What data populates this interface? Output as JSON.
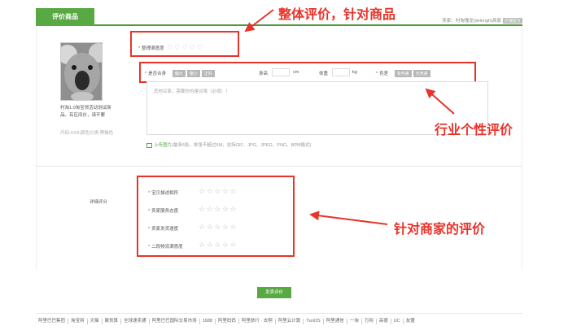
{
  "header": {
    "tab_label": "评价商品",
    "seller_prefix": "卖家：",
    "seller_name": "村淘懂龙(delongh)商家",
    "seller_badge": "店铺留言"
  },
  "product": {
    "title": "村淘1.0淘宝领活动测试商品。有区间价，请不要",
    "subtitle": "尺码:XXS;颜色分类:黑猫色"
  },
  "overall_rating": {
    "label": "整理满意度",
    "hearts": 5
  },
  "attributes": {
    "fit_label": "是否合身",
    "fit_options": [
      "偏大",
      "偏小",
      "正好"
    ],
    "height_label": "身高",
    "height_unit": "cm",
    "weight_label": "体重",
    "weight_unit": "kg",
    "color_label": "色差",
    "color_options": [
      "有色差",
      "无色差"
    ]
  },
  "review": {
    "placeholder": "其他买家，需要你的建议哦（必填）！"
  },
  "upload": {
    "link_text": "上传图片",
    "hint": "(最多5张，单张不超过5M，支持GIF、JPG、JPEG、PNG、BPM格式)"
  },
  "detail": {
    "label": "详细评分",
    "items": [
      {
        "label": "宝贝描述相符"
      },
      {
        "label": "卖家服务态度"
      },
      {
        "label": "卖家发货速度"
      },
      {
        "label": "二段物流满意度"
      }
    ],
    "stars": 5
  },
  "submit_label": "发表评价",
  "footer_links": [
    "阿里巴巴集团",
    "淘宝网",
    "天猫",
    "聚划算",
    "全球速卖通",
    "阿里巴巴国际交易市场",
    "1688",
    "阿里妈妈",
    "阿里旅行 · 去啊",
    "阿里云计算",
    "YunOS",
    "阿里通信",
    "一淘",
    "万网",
    "高德",
    "UC",
    "友盟"
  ],
  "annotations": {
    "overall": "整体评价，针对商品",
    "industry": "行业个性评价",
    "seller": "针对商家的评价"
  },
  "colors": {
    "accent": "#58a843",
    "annotation": "#e8332a",
    "chip": "#b8b8b8"
  }
}
